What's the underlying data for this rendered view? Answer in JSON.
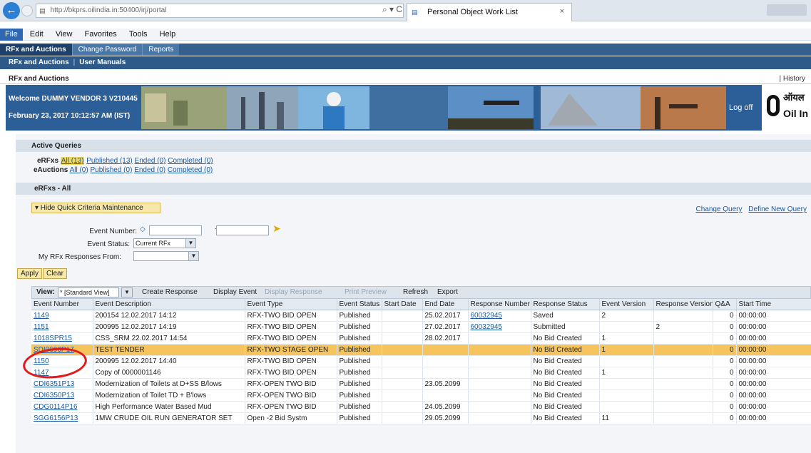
{
  "browser": {
    "url": "http://bkprs.oilindia.in:50400/irj/portal",
    "tab_title": "Personal Object Work List",
    "addr_controls": "⌕ ▾ C",
    "close_glyph": "×"
  },
  "menu": [
    "File",
    "Edit",
    "View",
    "Favorites",
    "Tools",
    "Help"
  ],
  "portal_nav": {
    "top_tabs": [
      "RFx and Auctions",
      "Change Password",
      "Reports"
    ],
    "second_level": [
      "RFx and Auctions",
      "User Manuals"
    ],
    "separator": "|",
    "page_title": "RFx and Auctions",
    "history": "| History"
  },
  "banner": {
    "welcome": "Welcome DUMMY VENDOR 3 V210445",
    "date": "February 23, 2017  10:12:57 AM (IST)",
    "logoff": "Log off",
    "logo_hindi": "ऑयल",
    "logo_english": "Oil In"
  },
  "active_queries": {
    "title": "Active Queries",
    "erfx_label": "eRFxs",
    "erfx_links": [
      "All (13)",
      "Published (13)",
      "Ended (0)",
      "Completed (0)"
    ],
    "eauction_label": "eAuctions",
    "eauction_links": [
      "All (0)",
      "Published (0)",
      "Ended (0)",
      "Completed (0)"
    ]
  },
  "erfx_section": {
    "title": "eRFxs - All",
    "toggle": "▾ Hide Quick Criteria Maintenance",
    "change_query": "Change Query",
    "define_query": "Define New Query",
    "event_number_label": "Event Number:",
    "to_label": "To",
    "event_status_label": "Event Status:",
    "event_status_value": "Current RFx",
    "responses_from_label": "My RFx Responses From:",
    "apply": "Apply",
    "clear": "Clear"
  },
  "toolbar": {
    "view_label": "View:",
    "view_value": "* [Standard View]",
    "create_response": "Create Response",
    "display_event": "Display Event",
    "display_response": "Display Response",
    "print_preview": "Print Preview",
    "refresh": "Refresh",
    "export": "Export"
  },
  "table": {
    "headers": [
      "Event Number",
      "Event Description",
      "Event Type",
      "Event Status",
      "Start Date",
      "End Date",
      "Response Number",
      "Response Status",
      "Event Version",
      "Response Version",
      "Q&A",
      "Start Time"
    ],
    "rows": [
      {
        "num": "1149",
        "desc": "200154 12.02.2017 14:12",
        "type": "RFX-TWO BID OPEN",
        "status": "Published",
        "start": "",
        "end": "25.02.2017",
        "resp": "60032945",
        "rstatus": "Saved",
        "ev": "2",
        "rv": "",
        "qa": "0",
        "time": "00:00:00"
      },
      {
        "num": "1151",
        "desc": "200995 12.02.2017 14:19",
        "type": "RFX-TWO BID OPEN",
        "status": "Published",
        "start": "",
        "end": "27.02.2017",
        "resp": "60032945",
        "rstatus": "Submitted",
        "ev": "",
        "rv": "2",
        "qa": "0",
        "time": "00:00:00"
      },
      {
        "num": "1018SPR15",
        "desc": "CSS_SRM 22.02.2017 14:54",
        "type": "RFX-TWO BID OPEN",
        "status": "Published",
        "start": "",
        "end": "28.02.2017",
        "resp": "",
        "rstatus": "No Bid Created",
        "ev": "1",
        "rv": "",
        "qa": "0",
        "time": "00:00:00"
      },
      {
        "num": "SDI0696P17",
        "desc": "TEST TENDER",
        "type": "RFX-TWO STAGE OPEN",
        "status": "Published",
        "start": "",
        "end": "",
        "resp": "",
        "rstatus": "No Bid Created",
        "ev": "1",
        "rv": "",
        "qa": "0",
        "time": "00:00:00",
        "highlight": true
      },
      {
        "num": "1150",
        "desc": "200995 12.02.2017 14:40",
        "type": "RFX-TWO BID OPEN",
        "status": "Published",
        "start": "",
        "end": "",
        "resp": "",
        "rstatus": "No Bid Created",
        "ev": "",
        "rv": "",
        "qa": "0",
        "time": "00:00:00"
      },
      {
        "num": "1147",
        "desc": "Copy of 0000001146",
        "type": "RFX-TWO BID OPEN",
        "status": "Published",
        "start": "",
        "end": "",
        "resp": "",
        "rstatus": "No Bid Created",
        "ev": "1",
        "rv": "",
        "qa": "0",
        "time": "00:00:00"
      },
      {
        "num": "CDI6351P13",
        "desc": "Modernization of Toilets at D+SS B/lows",
        "type": "RFX-OPEN TWO BID",
        "status": "Published",
        "start": "",
        "end": "23.05.2099",
        "resp": "",
        "rstatus": "No Bid Created",
        "ev": "",
        "rv": "",
        "qa": "0",
        "time": "00:00:00"
      },
      {
        "num": "CDI6350P13",
        "desc": "Modernization of Toilet TD + B'lows",
        "type": "RFX-OPEN TWO BID",
        "status": "Published",
        "start": "",
        "end": "",
        "resp": "",
        "rstatus": "No Bid Created",
        "ev": "",
        "rv": "",
        "qa": "0",
        "time": "00:00:00"
      },
      {
        "num": "CDG0114P16",
        "desc": "High Performance Water Based Mud",
        "type": "RFX-OPEN TWO BID",
        "status": "Published",
        "start": "",
        "end": "24.05.2099",
        "resp": "",
        "rstatus": "No Bid Created",
        "ev": "",
        "rv": "",
        "qa": "0",
        "time": "00:00:00"
      },
      {
        "num": "SGG6156P13",
        "desc": "1MW CRUDE OIL RUN GENERATOR SET",
        "type": "Open -2 Bid Systm",
        "status": "Published",
        "start": "",
        "end": "29.05.2099",
        "resp": "",
        "rstatus": "No Bid Created",
        "ev": "11",
        "rv": "",
        "qa": "0",
        "time": "00:00:00"
      }
    ]
  }
}
